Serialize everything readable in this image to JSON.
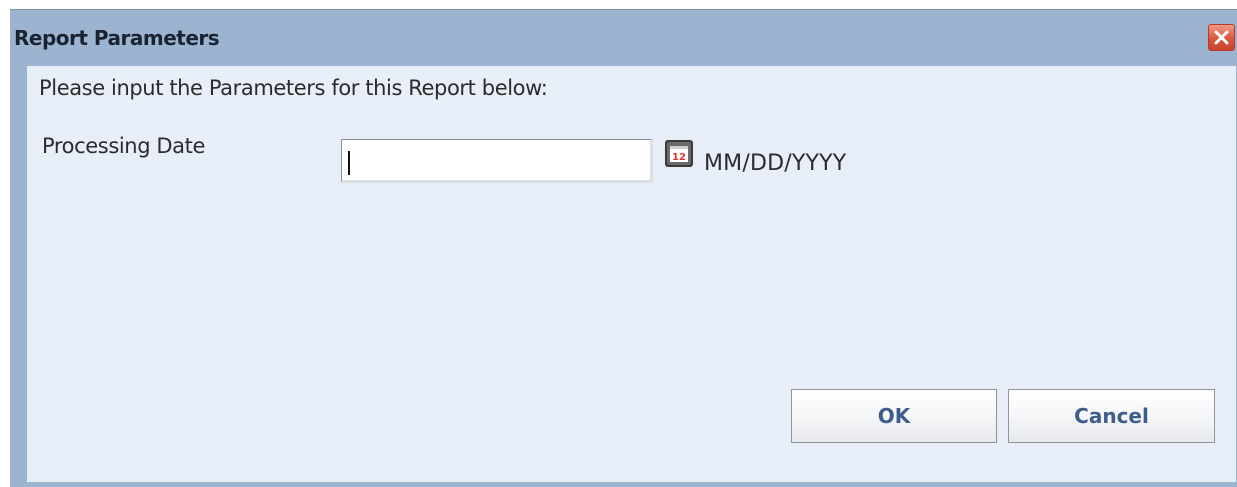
{
  "dialog": {
    "title": "Report Parameters",
    "close_icon": "close-x-icon",
    "instruction": "Please input the Parameters for this Report below:",
    "fields": [
      {
        "label": "Processing Date",
        "value": "",
        "picker_icon": "calendar-icon",
        "calendar_icon_text": "12",
        "format_hint": "MM/DD/YYYY"
      }
    ],
    "buttons": {
      "ok_label": "OK",
      "cancel_label": "Cancel"
    }
  },
  "colors": {
    "titlebar": "#9db4d1",
    "content_bg": "#e8eef7",
    "button_text": "#3f5d8c",
    "close_button": "#d9573e"
  }
}
